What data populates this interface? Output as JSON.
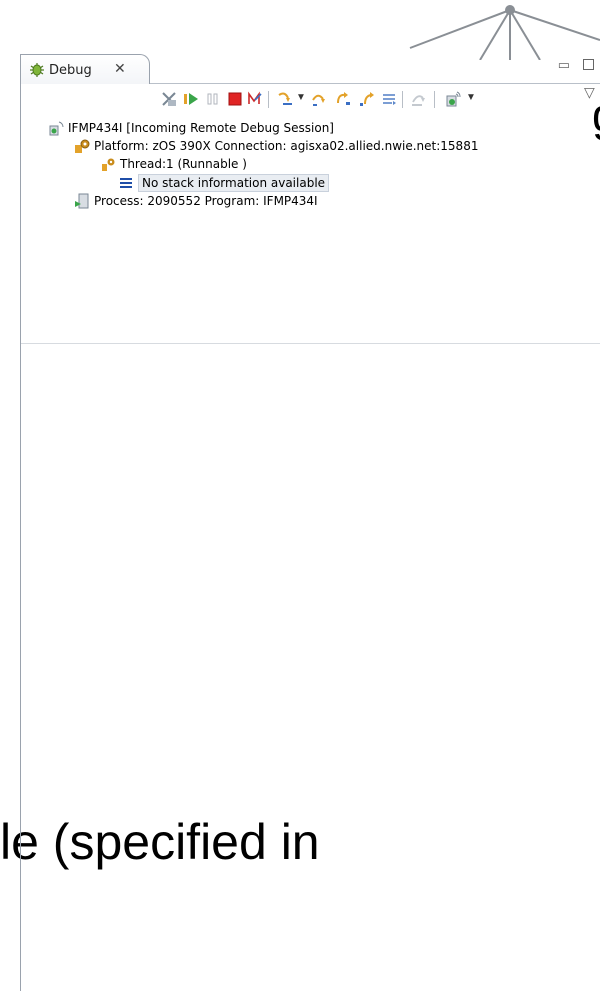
{
  "background": {
    "top_fragment": "g",
    "bottom_fragment": "le (specified in"
  },
  "debug_view": {
    "tab_label": "Debug",
    "tab_close": "✕",
    "icons": {
      "tab": "debug-bug-icon",
      "toolbar": [
        "remove-terminated-icon",
        "resume-icon",
        "suspend-icon",
        "terminate-icon",
        "disconnect-icon",
        "step-into-icon",
        "step-over-icon",
        "step-return-icon",
        "step-return-alt-icon",
        "drop-to-frame-icon",
        "step-filters-icon",
        "remote-debug-icon"
      ]
    },
    "tree": {
      "session": "IFMP434I [Incoming Remote Debug Session]",
      "platform": "Platform: zOS 390X   Connection: agisxa02.allied.nwie.net:15881",
      "thread": "Thread:1 (Runnable )",
      "stack": "No stack information available",
      "process": "Process: 2090552  Program: IFMP434I"
    }
  },
  "colors": {
    "border": "#9aa2ad",
    "selection": "#e9edf2",
    "terminate_red": "#e02424",
    "resume_green": "#3aa54a",
    "stack_blue": "#1f4ea8"
  }
}
